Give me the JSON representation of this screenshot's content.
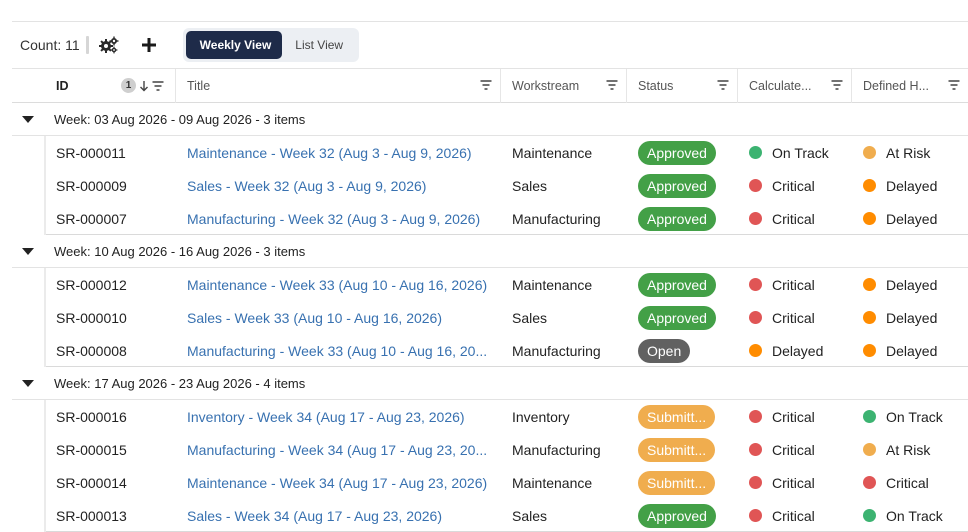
{
  "toolbar": {
    "count_label": "Count: 11",
    "settings_icon": "gears-icon",
    "add_icon": "plus-icon",
    "views": [
      {
        "label": "Weekly View",
        "active": true
      },
      {
        "label": "List View",
        "active": false
      }
    ]
  },
  "columns": {
    "id": "ID",
    "id_sort_order": "1",
    "title": "Title",
    "workstream": "Workstream",
    "status": "Status",
    "calculated": "Calculate...",
    "defined": "Defined H..."
  },
  "colors": {
    "approved": "#43a047",
    "open": "#616161",
    "submitted": "#f0ad4e",
    "on_track": "#3cb371",
    "at_risk": "#f0ad4e",
    "critical": "#e05555",
    "delayed": "#ff8c00",
    "link": "#3871b0",
    "active_view": "#1e2b49"
  },
  "groups": [
    {
      "label": "Week: 03 Aug 2026 - 09 Aug 2026 - 3 items",
      "rows": [
        {
          "id": "SR-000011",
          "title": "Maintenance - Week 32 (Aug 3 - Aug 9, 2026)",
          "workstream": "Maintenance",
          "status": "Approved",
          "status_key": "approved",
          "calc": "On Track",
          "calc_key": "on_track",
          "def": "At Risk",
          "def_key": "at_risk"
        },
        {
          "id": "SR-000009",
          "title": "Sales - Week 32 (Aug 3 - Aug 9, 2026)",
          "workstream": "Sales",
          "status": "Approved",
          "status_key": "approved",
          "calc": "Critical",
          "calc_key": "critical",
          "def": "Delayed",
          "def_key": "delayed"
        },
        {
          "id": "SR-000007",
          "title": "Manufacturing - Week 32 (Aug 3 - Aug 9, 2026)",
          "workstream": "Manufacturing",
          "status": "Approved",
          "status_key": "approved",
          "calc": "Critical",
          "calc_key": "critical",
          "def": "Delayed",
          "def_key": "delayed"
        }
      ]
    },
    {
      "label": "Week: 10 Aug 2026 - 16 Aug 2026 - 3 items",
      "rows": [
        {
          "id": "SR-000012",
          "title": "Maintenance - Week 33 (Aug 10 - Aug 16, 2026)",
          "workstream": "Maintenance",
          "status": "Approved",
          "status_key": "approved",
          "calc": "Critical",
          "calc_key": "critical",
          "def": "Delayed",
          "def_key": "delayed"
        },
        {
          "id": "SR-000010",
          "title": "Sales - Week 33 (Aug 10 - Aug 16, 2026)",
          "workstream": "Sales",
          "status": "Approved",
          "status_key": "approved",
          "calc": "Critical",
          "calc_key": "critical",
          "def": "Delayed",
          "def_key": "delayed"
        },
        {
          "id": "SR-000008",
          "title": "Manufacturing - Week 33 (Aug 10 - Aug 16, 20...",
          "workstream": "Manufacturing",
          "status": "Open",
          "status_key": "open",
          "calc": "Delayed",
          "calc_key": "delayed",
          "def": "Delayed",
          "def_key": "delayed"
        }
      ]
    },
    {
      "label": "Week: 17 Aug 2026 - 23 Aug 2026 - 4 items",
      "rows": [
        {
          "id": "SR-000016",
          "title": "Inventory - Week 34 (Aug 17 - Aug 23, 2026)",
          "workstream": "Inventory",
          "status": "Submitt...",
          "status_key": "submitted",
          "calc": "Critical",
          "calc_key": "critical",
          "def": "On Track",
          "def_key": "on_track"
        },
        {
          "id": "SR-000015",
          "title": "Manufacturing - Week 34 (Aug 17 - Aug 23, 20...",
          "workstream": "Manufacturing",
          "status": "Submitt...",
          "status_key": "submitted",
          "calc": "Critical",
          "calc_key": "critical",
          "def": "At Risk",
          "def_key": "at_risk"
        },
        {
          "id": "SR-000014",
          "title": "Maintenance - Week 34 (Aug 17 - Aug 23, 2026)",
          "workstream": "Maintenance",
          "status": "Submitt...",
          "status_key": "submitted",
          "calc": "Critical",
          "calc_key": "critical",
          "def": "Critical",
          "def_key": "critical"
        },
        {
          "id": "SR-000013",
          "title": "Sales - Week 34 (Aug 17 - Aug 23, 2026)",
          "workstream": "Sales",
          "status": "Approved",
          "status_key": "approved",
          "calc": "Critical",
          "calc_key": "critical",
          "def": "On Track",
          "def_key": "on_track"
        }
      ]
    }
  ]
}
